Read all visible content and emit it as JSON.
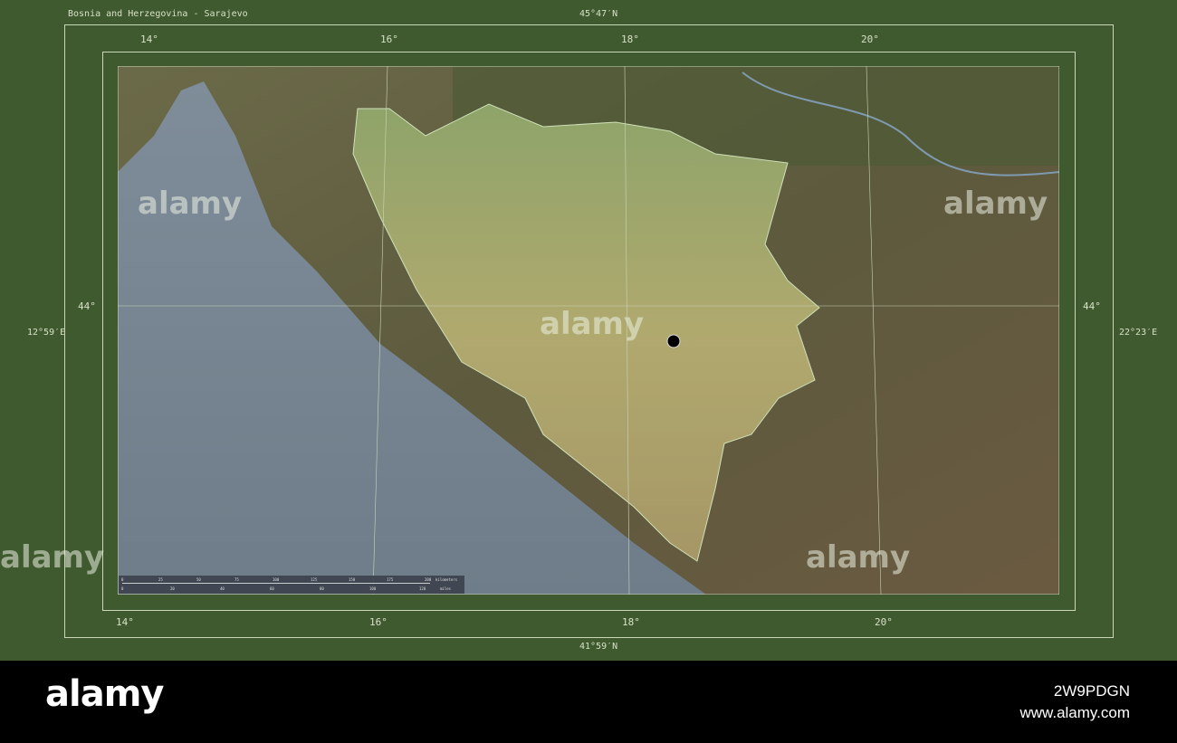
{
  "title": "Bosnia and Herzegovina - Sarajevo",
  "coords": {
    "top": "45°47′N",
    "bottom": "41°59′N",
    "left": "12°59′E",
    "right": "22°23′E"
  },
  "lon_ticks": [
    "14°",
    "16°",
    "18°",
    "20°"
  ],
  "lat_ticks": [
    "44°"
  ],
  "scale_bar": {
    "km": [
      "0",
      "25",
      "50",
      "75",
      "100",
      "125",
      "150",
      "175",
      "200"
    ],
    "km_unit": "kilometers",
    "mi": [
      "0",
      "20",
      "40",
      "60",
      "80",
      "100",
      "120"
    ],
    "mi_unit": "miles"
  },
  "watermark": {
    "brand": "alamy",
    "image_id": "2W9PDGN",
    "url": "www.alamy.com"
  },
  "colors": {
    "frame": "#3f5a2e",
    "country": "#a9b070",
    "marker": "#000000"
  }
}
